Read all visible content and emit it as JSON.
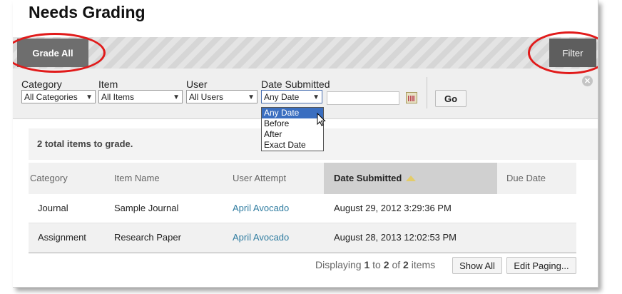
{
  "page": {
    "title": "Needs Grading"
  },
  "action_bar": {
    "grade_all_label": "Grade All",
    "filter_label": "Filter"
  },
  "filters": {
    "category_label": "Category",
    "category_value": "All Categories",
    "item_label": "Item",
    "item_value": "All Items",
    "user_label": "User",
    "user_value": "All Users",
    "date_label": "Date Submitted",
    "date_value": "Any Date",
    "date_input_value": "",
    "go_label": "Go",
    "date_options": [
      "Any Date",
      "Before",
      "After",
      "Exact Date"
    ],
    "highlighted_option": "Any Date"
  },
  "summary": {
    "text": "2 total items to grade."
  },
  "table": {
    "headers": {
      "category": "Category",
      "item_name": "Item Name",
      "user_attempt": "User Attempt",
      "date_submitted": "Date Submitted",
      "due_date": "Due Date"
    },
    "sorted_column": "Date Submitted",
    "sort_direction": "ascending",
    "rows": [
      {
        "category": "Journal",
        "item_name": "Sample Journal",
        "user_attempt": "April Avocado",
        "date_submitted": "August 29, 2012 3:29:36 PM",
        "due_date": ""
      },
      {
        "category": "Assignment",
        "item_name": "Research Paper",
        "user_attempt": "April Avocado",
        "date_submitted": "August 28, 2013 12:02:53 PM",
        "due_date": ""
      }
    ]
  },
  "paging": {
    "displaying": "Displaying",
    "from": "1",
    "to_word": "to",
    "to": "2",
    "of_word": "of",
    "total": "2",
    "items_word": "items",
    "show_all_label": "Show All",
    "edit_paging_label": "Edit Paging..."
  },
  "colors": {
    "link": "#2f7ca0",
    "highlight_ring": "#e11a1a",
    "dropdown_selected": "#3a6ec0",
    "active_header": "#d0d0d0"
  }
}
